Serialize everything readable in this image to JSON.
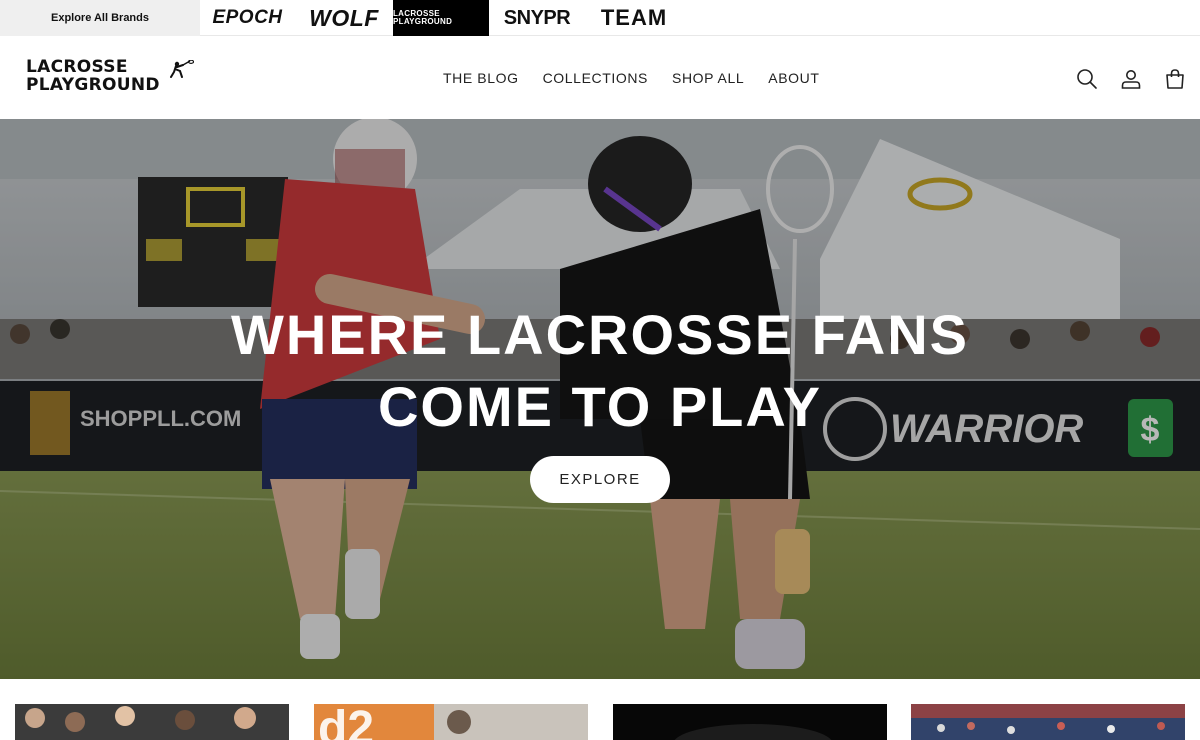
{
  "brand_bar": {
    "explore_label": "Explore All Brands",
    "brands": [
      "EPOCH",
      "WOLF",
      "LACROSSE PLAYGROUND",
      "SNYPR",
      "TEAM"
    ]
  },
  "header": {
    "logo": {
      "line1": "LACROSSE",
      "line2": "PLAYGROUND"
    },
    "nav": [
      "THE BLOG",
      "COLLECTIONS",
      "SHOP ALL",
      "ABOUT"
    ],
    "icons": [
      "search-icon",
      "account-icon",
      "cart-icon"
    ]
  },
  "hero": {
    "title_line1": "WHERE LACROSSE FANS",
    "title_line2": "COME TO PLAY",
    "button_label": "EXPLORE",
    "signage": [
      "WARRIOR",
      "SHOPPLL.COM"
    ]
  },
  "colors": {
    "brand_black": "#000000",
    "explore_bg": "#efefef",
    "jersey_red": "#d3343a",
    "jersey_black": "#1a1a1a",
    "accent_purple": "#6b3fb5"
  }
}
